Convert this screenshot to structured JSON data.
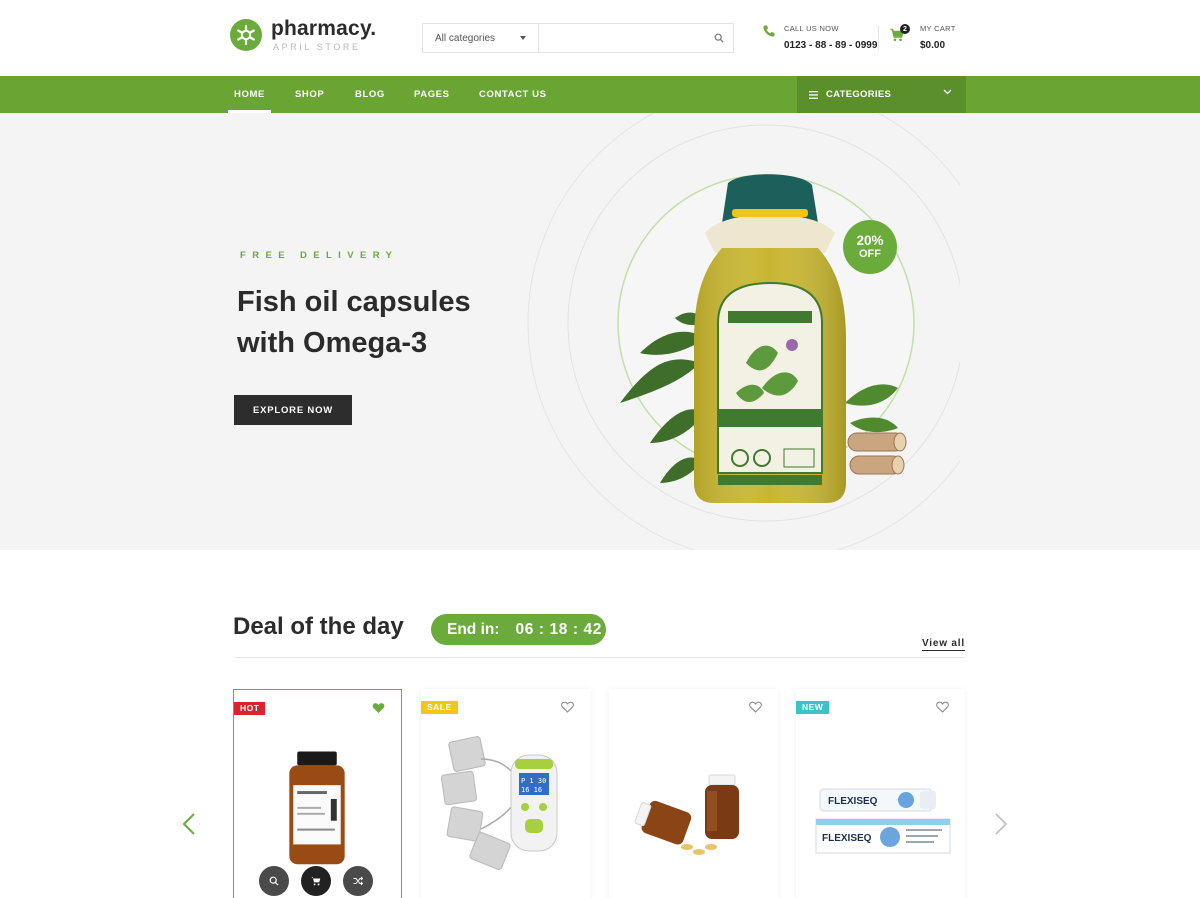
{
  "brand": {
    "name": "pharmacy.",
    "tagline": "APRIL STORE"
  },
  "search": {
    "category": "All categories",
    "placeholder": ""
  },
  "call": {
    "label": "CALL US NOW",
    "phone": "0123 - 88 - 89 - 0999"
  },
  "cart": {
    "label": "MY CART",
    "total": "$0.00",
    "count": "2"
  },
  "nav": {
    "items": [
      {
        "label": "HOME",
        "active": true
      },
      {
        "label": "SHOP"
      },
      {
        "label": "BLOG"
      },
      {
        "label": "PAGES"
      },
      {
        "label": "CONTACT US"
      }
    ],
    "categories_label": "CATEGORIES"
  },
  "hero": {
    "eyebrow": "FREE DELIVERY",
    "title_line1": "Fish oil capsules",
    "title_line2": "with Omega-3",
    "button": "EXPLORE NOW",
    "badge_pct": "20%",
    "badge_off": "OFF"
  },
  "deal": {
    "title": "Deal of the day",
    "timer_label": "End in:",
    "timer_value": "06 : 18 : 42",
    "view_all": "View all",
    "cards": [
      {
        "tag": "HOT",
        "tag_color": "#d9232d",
        "favorited": true
      },
      {
        "tag": "SALE",
        "tag_color": "#f5c518",
        "favorited": false
      },
      {
        "tag": "",
        "favorited": false
      },
      {
        "tag": "NEW",
        "tag_color": "#3cc3c8",
        "favorited": false
      }
    ]
  },
  "colors": {
    "accent": "#6aab3c",
    "nav": "#6aa534",
    "dark": "#2d2d2d"
  }
}
